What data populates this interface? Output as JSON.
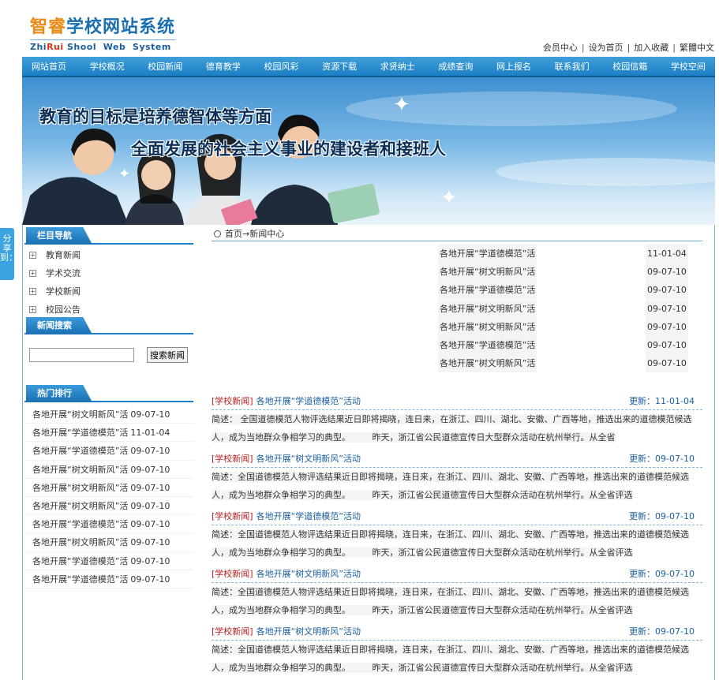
{
  "header": {
    "logo_cn_part1": "智睿",
    "logo_cn_part2": "学校网站系统",
    "logo_en_part1": "Zhi",
    "logo_en_part2": "Rui",
    "logo_en_part3": " Shool  Web  System",
    "links": [
      "会员中心",
      "设为首页",
      "加入收藏",
      "繁體中文"
    ],
    "link_sep": "|"
  },
  "nav": [
    "网站首页",
    "学校概况",
    "校园新闻",
    "德育教学",
    "校园风彩",
    "资源下载",
    "求贤纳士",
    "成绩查询",
    "网上报名",
    "联系我们",
    "校园信箱",
    "学校空间"
  ],
  "banner": {
    "line1": "教育的目标是培养德智体等方面",
    "line2": "全面发展的社会主义事业的建设者和接班人"
  },
  "share": "分享到：",
  "sidebar": {
    "nav_title": "栏目导航",
    "categories": [
      "教育新闻",
      "学术交流",
      "学校新闻",
      "校园公告"
    ],
    "plus": "+",
    "search_title": "新闻搜索",
    "search_button": "搜索新闻",
    "search_placeholder": "",
    "hot_title": "热门排行",
    "hot": [
      {
        "title": "各地开展“树文明新风”活",
        "date": "09-07-10"
      },
      {
        "title": "各地开展“学道德模范”活",
        "date": "11-01-04"
      },
      {
        "title": "各地开展“学道德模范”活",
        "date": "09-07-10"
      },
      {
        "title": "各地开展“树文明新风”活",
        "date": "09-07-10"
      },
      {
        "title": "各地开展“树文明新风”活",
        "date": "09-07-10"
      },
      {
        "title": "各地开展“树文明新风”活",
        "date": "09-07-10"
      },
      {
        "title": "各地开展“学道德模范”活",
        "date": "09-07-10"
      },
      {
        "title": "各地开展“树文明新风”活",
        "date": "09-07-10"
      },
      {
        "title": "各地开展“学道德模范”活",
        "date": "09-07-10"
      },
      {
        "title": "各地开展“学道德模范”活",
        "date": "09-07-10"
      }
    ]
  },
  "main": {
    "breadcrumb": "首页→新闻中心",
    "top_list": [
      {
        "title": "各地开展“学道德模范”活",
        "date": "11-01-04"
      },
      {
        "title": "各地开展“树文明新风”活",
        "date": "09-07-10"
      },
      {
        "title": "各地开展“学道德模范”活",
        "date": "09-07-10"
      },
      {
        "title": "各地开展“树文明新风”活",
        "date": "09-07-10"
      },
      {
        "title": "各地开展“树文明新风”活",
        "date": "09-07-10"
      },
      {
        "title": "各地开展“学道德模范”活",
        "date": "09-07-10"
      },
      {
        "title": "各地开展“树文明新风”活",
        "date": "09-07-10"
      }
    ],
    "news": [
      {
        "tag": "[学校新闻]",
        "title": "各地开展“学道德模范”活动",
        "updated": "更新：11-01-04",
        "summary": "简述： 全国道德模范人物评选结果近日即将揭晓，连日来，在浙江、四川、湖北、安徽、广西等地，推选出来的道德模范候选人，成为当地群众争相学习的典型。　　　昨天，浙江省公民道德宣传日大型群众活动在杭州举行。从全省"
      },
      {
        "tag": "[学校新闻]",
        "title": "各地开展“树文明新风”活动",
        "updated": "更新：09-07-10",
        "summary": "简述：全国道德模范人物评选结果近日即将揭晓，连日来，在浙江、四川、湖北、安徽、广西等地，推选出来的道德模范候选人，成为当地群众争相学习的典型。　　　昨天，浙江省公民道德宣传日大型群众活动在杭州举行。从全省评选"
      },
      {
        "tag": "[学校新闻]",
        "title": "各地开展“学道德模范”活动",
        "updated": "更新：09-07-10",
        "summary": "简述：全国道德模范人物评选结果近日即将揭晓，连日来，在浙江、四川、湖北、安徽、广西等地，推选出来的道德模范候选人，成为当地群众争相学习的典型。　　　昨天，浙江省公民道德宣传日大型群众活动在杭州举行。从全省评选"
      },
      {
        "tag": "[学校新闻]",
        "title": "各地开展“树文明新风”活动",
        "updated": "更新：09-07-10",
        "summary": "简述：全国道德模范人物评选结果近日即将揭晓，连日来，在浙江、四川、湖北、安徽、广西等地，推选出来的道德模范候选人，成为当地群众争相学习的典型。　　　昨天，浙江省公民道德宣传日大型群众活动在杭州举行。从全省评选"
      },
      {
        "tag": "[学校新闻]",
        "title": "各地开展“树文明新风”活动",
        "updated": "更新：09-07-10",
        "summary": "简述：全国道德模范人物评选结果近日即将揭晓，连日来，在浙江、四川、湖北、安徽、广西等地，推选出来的道德模范候选人，成为当地群众争相学习的典型。　　　昨天，浙江省公民道德宣传日大型群众活动在杭州举行。从全省评选"
      }
    ]
  },
  "colors": {
    "nav": "#1c7fc4",
    "logo_blue": "#1a6fb0",
    "logo_orange": "#e88a14",
    "tag_red": "#b42020",
    "link_blue": "#1a5fa0"
  }
}
